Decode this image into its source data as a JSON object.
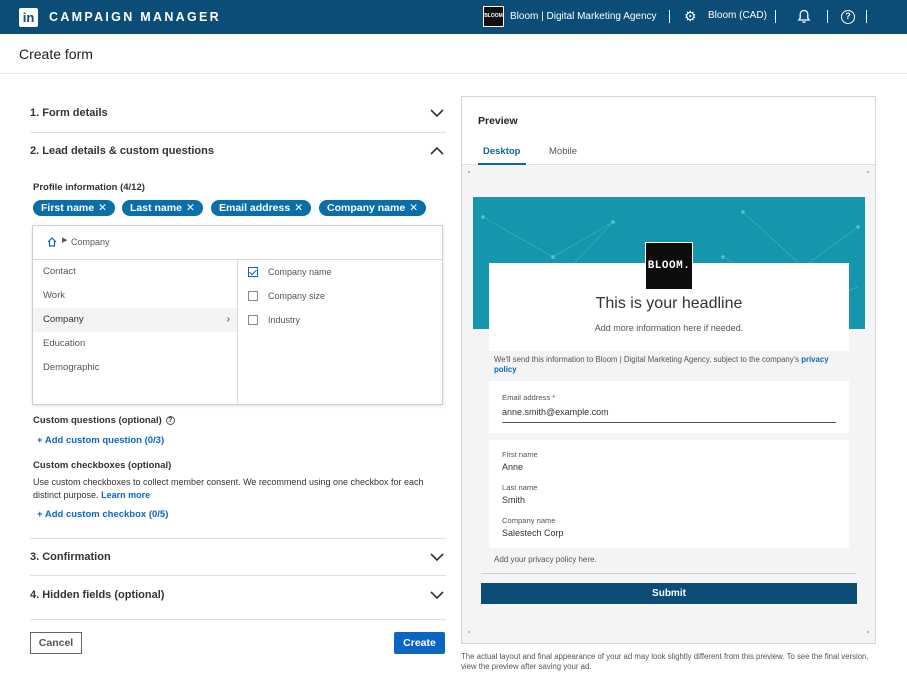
{
  "topbar": {
    "logo": "in",
    "app_title": "CAMPAIGN MANAGER",
    "account_thumb_text": "BLOOM",
    "account_name": "Bloom | Digital Marketing Agency",
    "account_currency": "Bloom (CAD)",
    "icons": [
      "linkedin-logo",
      "gear-icon",
      "bell-icon",
      "help-icon"
    ]
  },
  "page": {
    "title": "Create form"
  },
  "sections": {
    "form_details": "1.  Form details",
    "lead_details": "2.  Lead details & custom questions",
    "confirmation": "3.  Confirmation",
    "hidden_fields": "4.  Hidden fields (optional)"
  },
  "profile_info": {
    "label": "Profile information (4/12)",
    "pills": [
      "First name",
      "Last name",
      "Email address",
      "Company name"
    ],
    "pill_close": "✕"
  },
  "picker": {
    "breadcrumb": "Company",
    "categories": [
      "Contact",
      "Work",
      "Company",
      "Education",
      "Demographic"
    ],
    "active_category": "Company",
    "options": [
      {
        "label": "Company name",
        "checked": true
      },
      {
        "label": "Company size",
        "checked": false
      },
      {
        "label": "Industry",
        "checked": false
      }
    ]
  },
  "custom_questions": {
    "label": "Custom questions (optional)",
    "add_link": "+ Add custom question (0/3)"
  },
  "custom_checkboxes": {
    "label": "Custom checkboxes (optional)",
    "description": "Use custom checkboxes to collect member consent. We recommend using one checkbox for each distinct purpose.",
    "learn_more": "Learn more",
    "add_link": "+ Add custom checkbox (0/5)"
  },
  "buttons": {
    "cancel": "Cancel",
    "create": "Create"
  },
  "preview": {
    "title": "Preview",
    "tabs": [
      "Desktop",
      "Mobile"
    ],
    "active_tab": "Desktop",
    "brand_logo": "BLOOM.",
    "headline": "This is your headline",
    "subheadline": "Add more information here if needed.",
    "consent_text": "We'll send this information to Bloom | Digital Marketing Agency, subject to the company's",
    "privacy_link": "privacy policy",
    "email_label": "Email address *",
    "email_value": "anne.smith@example.com",
    "fields": [
      {
        "label": "First name",
        "value": "Anne"
      },
      {
        "label": "Last name",
        "value": "Smith"
      },
      {
        "label": "Company name",
        "value": "Salestech Corp"
      }
    ],
    "privacy_note": "Add your privacy policy here.",
    "submit": "Submit",
    "disclaimer": "The actual layout and final appearance of your ad may look slightly different from this preview. To see the final version, view the preview after saving your ad."
  },
  "colors": {
    "topbar": "#0b4d77",
    "accent": "#0a66c2",
    "pill": "#0a6ea8",
    "banner": "#1596ad",
    "submit": "#0b4d77"
  }
}
